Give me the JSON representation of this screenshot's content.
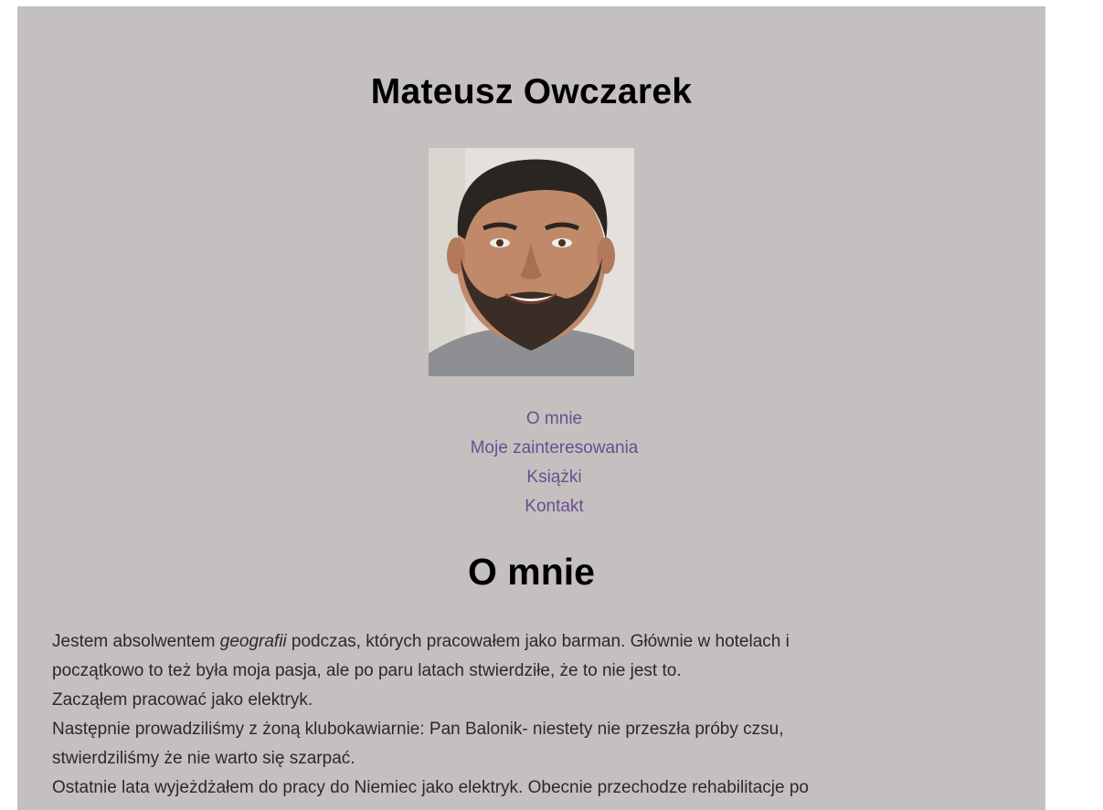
{
  "header": {
    "site_title": "Mateusz Owczarek",
    "photo_alt": "Mateusz Owczarek"
  },
  "nav": {
    "items": [
      {
        "label": "O mnie"
      },
      {
        "label": "Moje zainteresowania"
      },
      {
        "label": "Książki"
      },
      {
        "label": "Kontakt"
      }
    ]
  },
  "about": {
    "title": "O mnie",
    "line1_before": "Jestem absolwentem ",
    "line1_em": "geografii",
    "line1_after": " podczas, których pracowałem jako barman. Głównie w hotelach i",
    "line2": "początkowo to też była moja pasja, ale po paru latach stwierdziłe, że to nie jest to.",
    "line3": "Zacząłem pracować jako elektryk.",
    "line4": "Następnie prowadziliśmy z żoną klubokawiarnie: Pan Balonik- niestety nie przeszła próby czsu,",
    "line5": "stwierdziliśmy że nie warto się szarpać.",
    "line6": "Ostatnie lata wyjeżdżałem do pracy do Niemiec jako elektryk. Obecnie przechodze rehabilitacje po"
  },
  "colors": {
    "page_background": "#c4c0bf",
    "link": "#6a4f8e"
  }
}
